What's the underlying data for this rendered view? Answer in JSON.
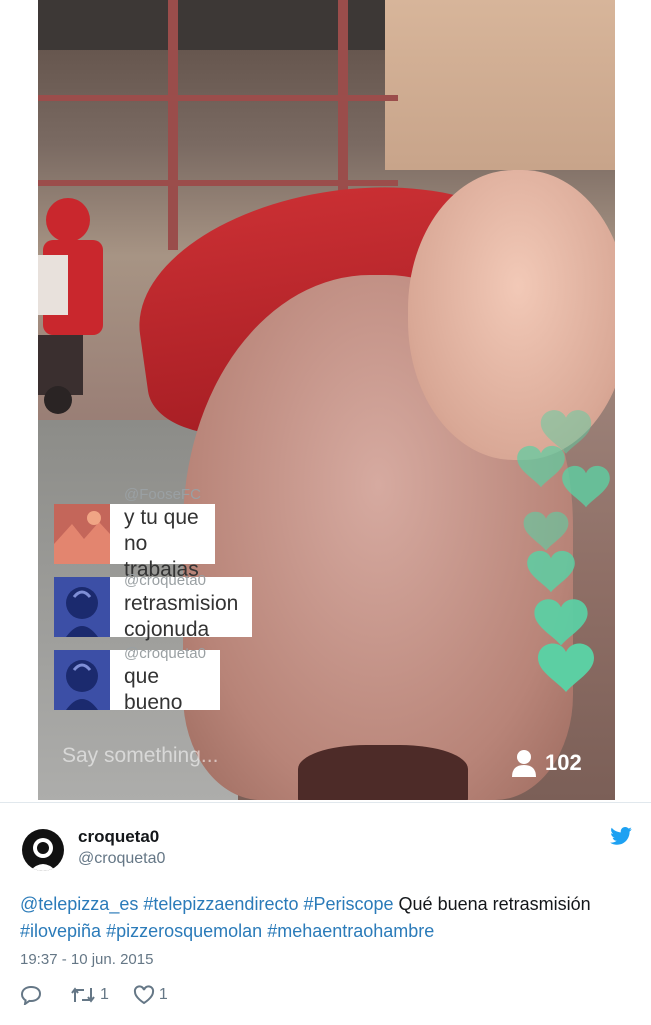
{
  "video": {
    "comments": [
      {
        "handle": "@FooseFC",
        "text": "y tu que no trabajas"
      },
      {
        "handle": "@croqueta0",
        "text": "retrasmision cojonuda"
      },
      {
        "handle": "@croqueta0",
        "text": "que bueno"
      }
    ],
    "input_placeholder": "Say something...",
    "viewer_count": "102",
    "heart_color": "#5ccfa3"
  },
  "tweet": {
    "display_name": "croqueta0",
    "handle": "@croqueta0",
    "text_parts": [
      {
        "text": "@telepizza_es",
        "link": true
      },
      {
        "text": " ",
        "link": false
      },
      {
        "text": "#telepizzaendirecto",
        "link": true
      },
      {
        "text": " ",
        "link": false
      },
      {
        "text": "#Periscope",
        "link": true
      },
      {
        "text": " Qué buena retrasmisión ",
        "link": false
      },
      {
        "text": "#ilovepiña",
        "link": true
      },
      {
        "text": " ",
        "link": false
      },
      {
        "text": "#pizzerosquemolan",
        "link": true
      },
      {
        "text": " ",
        "link": false
      },
      {
        "text": "#mehaentraohambre",
        "link": true
      }
    ],
    "timestamp": "19:37 - 10 jun. 2015",
    "retweets": "1",
    "likes": "1",
    "link_color": "#2b7bb9"
  }
}
